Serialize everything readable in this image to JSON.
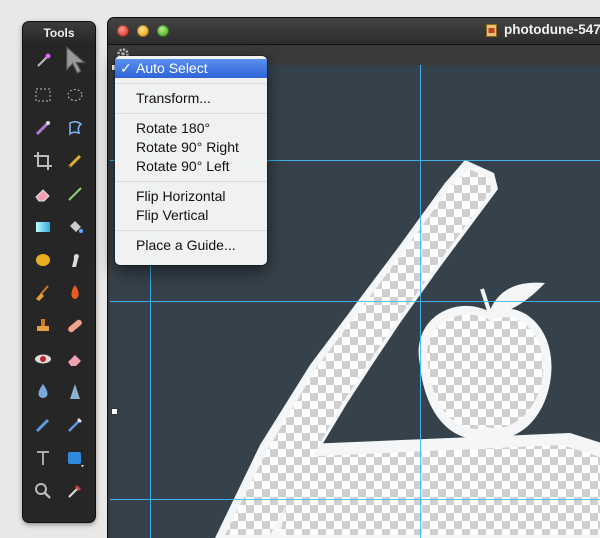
{
  "tools_panel": {
    "title": "Tools",
    "tools": [
      {
        "name": "magic-wand-tool-icon"
      },
      {
        "name": "move-tool-icon"
      },
      {
        "name": "rect-marquee-tool-icon"
      },
      {
        "name": "ellipse-marquee-tool-icon"
      },
      {
        "name": "brush-select-tool-icon"
      },
      {
        "name": "lasso-tool-icon"
      },
      {
        "name": "crop-tool-icon"
      },
      {
        "name": "pencil-tool-icon"
      },
      {
        "name": "eraser-tool-icon"
      },
      {
        "name": "line-tool-icon"
      },
      {
        "name": "gradient-tool-icon"
      },
      {
        "name": "paint-bucket-tool-icon"
      },
      {
        "name": "sponge-tool-icon"
      },
      {
        "name": "smudge-tool-icon"
      },
      {
        "name": "broom-tool-icon"
      },
      {
        "name": "burn-tool-icon"
      },
      {
        "name": "clone-stamp-tool-icon"
      },
      {
        "name": "bandage-tool-icon"
      },
      {
        "name": "red-eye-tool-icon"
      },
      {
        "name": "eraser-alt-tool-icon"
      },
      {
        "name": "blur-tool-icon"
      },
      {
        "name": "sharpen-tool-icon"
      },
      {
        "name": "brush-tool-icon"
      },
      {
        "name": "pen-tool-icon"
      },
      {
        "name": "text-tool-icon"
      },
      {
        "name": "shape-tool-icon"
      },
      {
        "name": "zoom-tool-icon"
      },
      {
        "name": "eyedropper-tool-icon"
      }
    ]
  },
  "window": {
    "title": "photodune-547"
  },
  "menu": {
    "items": [
      {
        "label": "Auto Select",
        "checked": true
      },
      {
        "label": "Transform..."
      },
      {
        "label": "Rotate 180°"
      },
      {
        "label": "Rotate 90° Right"
      },
      {
        "label": "Rotate 90° Left"
      },
      {
        "label": "Flip Horizontal"
      },
      {
        "label": "Flip Vertical"
      },
      {
        "label": "Place a Guide..."
      }
    ],
    "check_mark": "✓"
  },
  "colors": {
    "guide": "#3fb9ff",
    "menu_highlight": "#2f63d8",
    "canvas_bg": "#36424b"
  }
}
